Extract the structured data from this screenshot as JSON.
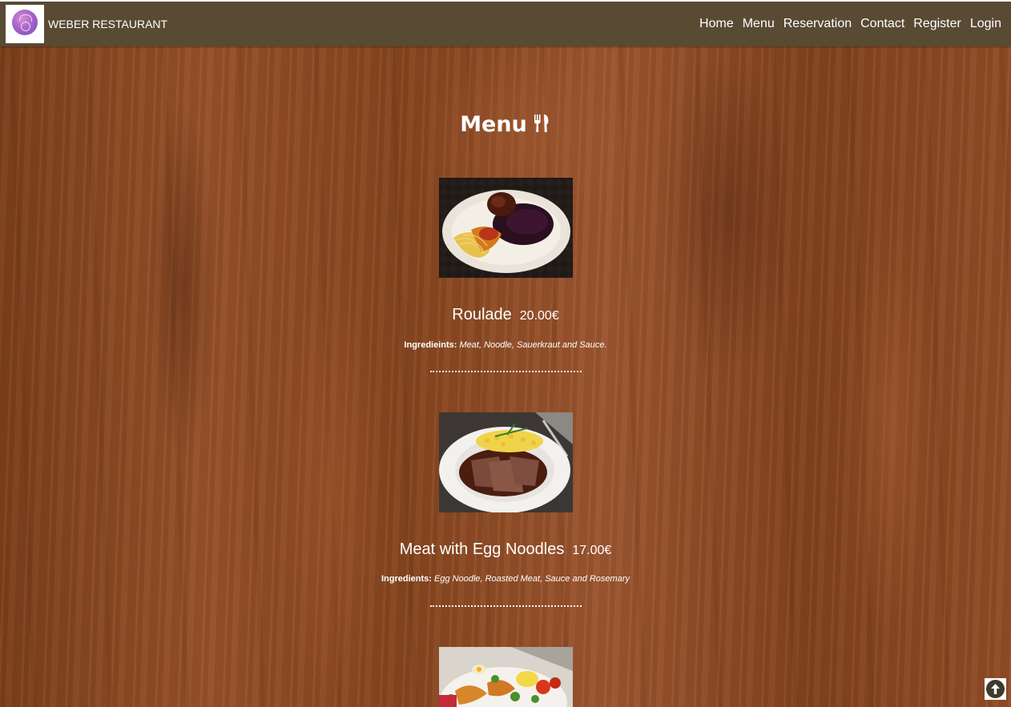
{
  "brand": {
    "name": "WEBER RESTAURANT",
    "logo_icon": "chef-logo-icon"
  },
  "nav": {
    "items": [
      {
        "label": "Home"
      },
      {
        "label": "Menu"
      },
      {
        "label": "Reservation"
      },
      {
        "label": "Contact"
      },
      {
        "label": "Register"
      },
      {
        "label": "Login"
      }
    ]
  },
  "page": {
    "title": "Menu",
    "title_icon": "utensils-icon"
  },
  "menu": {
    "items": [
      {
        "name": "Roulade",
        "price": "20.00€",
        "ingredients_label": "Ingredieints:",
        "ingredients": "Meat, Noodle, Sauerkraut and Sauce.",
        "image": "roulade-dish-photo"
      },
      {
        "name": "Meat with Egg Noodles",
        "price": "17.00€",
        "ingredients_label": "Ingredients:",
        "ingredients": "Egg Noodle, Roasted Meat, Sauce and Rosemary",
        "image": "meat-egg-noodles-dish-photo"
      },
      {
        "name": "",
        "price": "",
        "ingredients_label": "",
        "ingredients": "",
        "image": "salad-dish-photo"
      }
    ]
  },
  "scroll_top": {
    "icon": "arrow-up-circle-icon"
  },
  "colors": {
    "navbar": "#594a34",
    "wood": "#8a4a22",
    "text": "#ffffff"
  }
}
